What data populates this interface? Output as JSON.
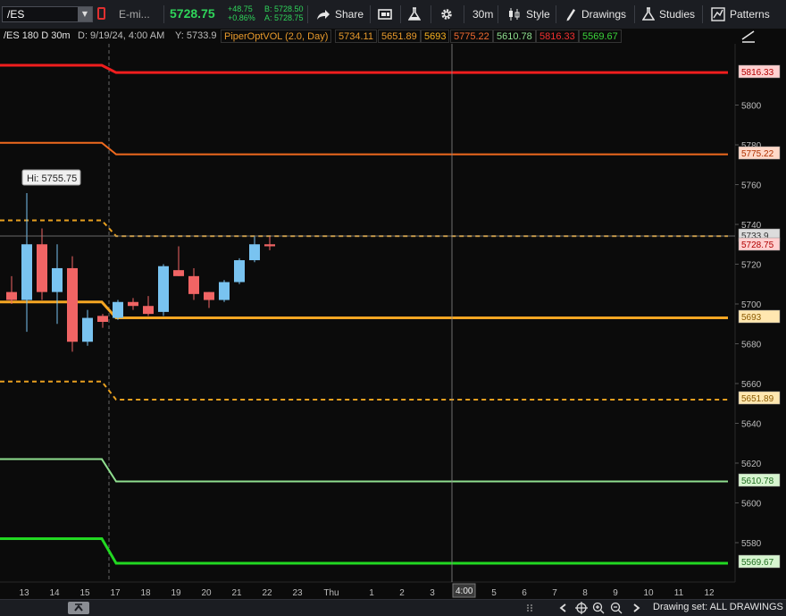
{
  "toolbar": {
    "symbol": "/ES",
    "description": "E-mi...",
    "last_price": "5728.75",
    "change": "+48.75",
    "change_pct": "+0.86%",
    "bid": "B: 5728.50",
    "ask": "A: 5728.75",
    "share_label": "Share",
    "interval_label": "30m",
    "style_label": "Style",
    "drawings_label": "Drawings",
    "studies_label": "Studies",
    "patterns_label": "Patterns"
  },
  "info_bar": {
    "chart_label": "/ES 180 D 30m",
    "date_label": "D: 9/19/24, 4:00 AM",
    "y_label": "Y: 5733.9",
    "study_label": "PiperOptVOL (2.0, Day)",
    "study_values": [
      {
        "value": "5734.11",
        "color": "#e89a2c"
      },
      {
        "value": "5651.89",
        "color": "#e89a2c"
      },
      {
        "value": "5693",
        "color": "#f5b020"
      },
      {
        "value": "5775.22",
        "color": "#f06a30"
      },
      {
        "value": "5610.78",
        "color": "#8fdf8f"
      },
      {
        "value": "5816.33",
        "color": "#f03030"
      },
      {
        "value": "5569.67",
        "color": "#3ad23a"
      }
    ]
  },
  "hi_label": "Hi: 5755.75",
  "crosshair_time": "4:00",
  "bottom_bar": {
    "drawing_set": "Drawing set: ALL DRAWINGS"
  },
  "chart_data": {
    "type": "candlestick",
    "y_ticks": [
      5580,
      5600,
      5620,
      5640,
      5660,
      5680,
      5700,
      5720,
      5740,
      5760,
      5780,
      5800
    ],
    "ylim": [
      5560,
      5830
    ],
    "x_ticks": [
      "13",
      "14",
      "15",
      "17",
      "18",
      "19",
      "20",
      "21",
      "22",
      "23",
      "Thu",
      "1",
      "2",
      "3",
      "4:00",
      "5",
      "6",
      "7",
      "8",
      "9",
      "10",
      "11",
      "12"
    ],
    "price_labels": [
      {
        "value": "5816.33",
        "bg": "#ffd0d0",
        "fg": "#b00000"
      },
      {
        "value": "5775.22",
        "bg": "#ffd8c8",
        "fg": "#b03000"
      },
      {
        "value": "5733.9",
        "bg": "#dcdcdc",
        "fg": "#333333"
      },
      {
        "value": "5728.75",
        "bg": "#ffd0d0",
        "fg": "#b00000"
      },
      {
        "value": "5693",
        "bg": "#ffe7b0",
        "fg": "#8a5a00"
      },
      {
        "value": "5651.89",
        "bg": "#ffe7b0",
        "fg": "#8a5a00"
      },
      {
        "value": "5610.78",
        "bg": "#d7f5d0",
        "fg": "#1f6d1f"
      },
      {
        "value": "5569.67",
        "bg": "#d7f5d0",
        "fg": "#1f6d1f"
      }
    ],
    "levels": [
      {
        "name": "5816.33",
        "prev": 5820,
        "value": 5816.33,
        "color": "#f01e1e",
        "dash": false,
        "width": 3
      },
      {
        "name": "5775.22",
        "prev": 5781,
        "value": 5775.22,
        "color": "#f06a1e",
        "dash": false,
        "width": 2
      },
      {
        "name": "5734.11",
        "prev": 5742,
        "value": 5734.11,
        "color": "#e8a020",
        "dash": true,
        "width": 2
      },
      {
        "name": "5693",
        "prev": 5701,
        "value": 5693,
        "color": "#f5a623",
        "dash": false,
        "width": 3
      },
      {
        "name": "5651.89",
        "prev": 5661,
        "value": 5651.89,
        "color": "#e8a020",
        "dash": true,
        "width": 2
      },
      {
        "name": "5610.78",
        "prev": 5622,
        "value": 5610.78,
        "color": "#8fdf8f",
        "dash": false,
        "width": 2
      },
      {
        "name": "5569.67",
        "prev": 5582,
        "value": 5569.67,
        "color": "#22d822",
        "dash": false,
        "width": 3
      }
    ],
    "candles": [
      {
        "open": 5706,
        "high": 5714,
        "low": 5700,
        "close": 5702
      },
      {
        "open": 5702,
        "high": 5755.75,
        "low": 5686,
        "close": 5730
      },
      {
        "open": 5730,
        "high": 5738,
        "low": 5702,
        "close": 5706
      },
      {
        "open": 5706,
        "high": 5730,
        "low": 5690,
        "close": 5718
      },
      {
        "open": 5718,
        "high": 5724,
        "low": 5676,
        "close": 5681
      },
      {
        "open": 5681,
        "high": 5697,
        "low": 5679,
        "close": 5693
      },
      {
        "open": 5694,
        "high": 5695,
        "low": 5688,
        "close": 5691
      },
      {
        "open": 5693,
        "high": 5702,
        "low": 5692,
        "close": 5701
      },
      {
        "open": 5701,
        "high": 5703,
        "low": 5697,
        "close": 5699
      },
      {
        "open": 5699,
        "high": 5704,
        "low": 5694,
        "close": 5695
      },
      {
        "open": 5696,
        "high": 5720,
        "low": 5694,
        "close": 5719
      },
      {
        "open": 5717,
        "high": 5729,
        "low": 5714,
        "close": 5714
      },
      {
        "open": 5714,
        "high": 5718,
        "low": 5702,
        "close": 5705
      },
      {
        "open": 5706,
        "high": 5706,
        "low": 5698,
        "close": 5702
      },
      {
        "open": 5702,
        "high": 5712,
        "low": 5701,
        "close": 5711
      },
      {
        "open": 5711,
        "high": 5723,
        "low": 5710,
        "close": 5722
      },
      {
        "open": 5722,
        "high": 5734,
        "low": 5721,
        "close": 5730
      },
      {
        "open": 5730,
        "high": 5734,
        "low": 5727,
        "close": 5729
      }
    ]
  }
}
